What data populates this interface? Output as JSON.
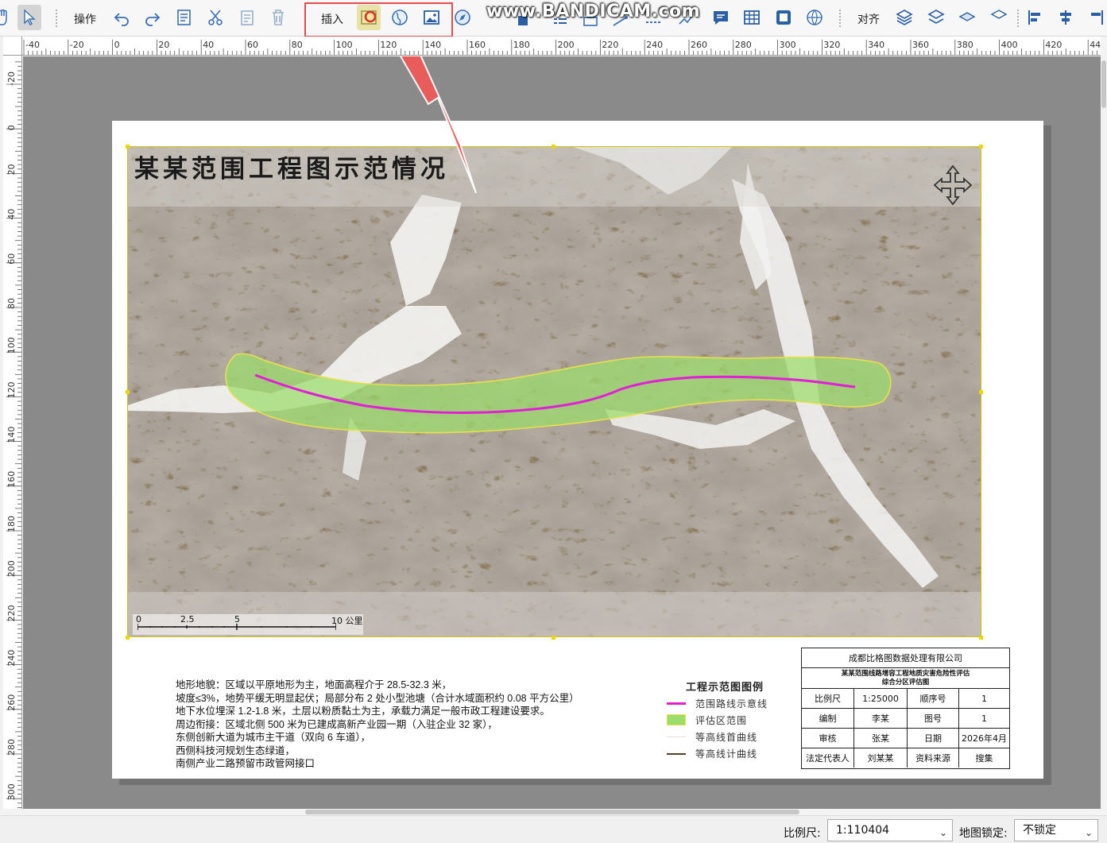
{
  "toolbar": {
    "operate_label": "操作",
    "insert_label": "插入",
    "align_label": "对齐"
  },
  "watermark": "www.BANDICAM.com",
  "ruler": {
    "h_ticks": [
      "-40",
      "-20",
      "0",
      "20",
      "40",
      "60",
      "80",
      "100",
      "120",
      "140",
      "160",
      "180",
      "200",
      "220",
      "240",
      "260",
      "280",
      "300",
      "320",
      "340",
      "360",
      "380",
      "400",
      "420",
      "440"
    ],
    "v_ticks": [
      "-20",
      "0",
      "20",
      "40",
      "60",
      "80",
      "100",
      "120",
      "140",
      "160",
      "180",
      "200",
      "220",
      "240",
      "260",
      "280",
      "300"
    ]
  },
  "map": {
    "title": "某某范围工程图示范情况",
    "scalebar": {
      "labels": [
        "0",
        "2.5",
        "5",
        "10 公里"
      ]
    }
  },
  "description": {
    "lines": [
      "地形地貌：区域以平原地形为主，地面高程介于 28.5-32.3 米，",
      "坡度≤3%，地势平缓无明显起伏；局部分布 2 处小型池塘（合计水域面积约 0.08 平方公里）",
      "地下水位埋深 1.2-1.8 米，土层以粉质黏土为主，承载力满足一般市政工程建设要求。",
      "周边衔接：区域北侧 500 米为已建成高新产业园一期（入驻企业 32 家），",
      "东侧创新大道为城市主干道（双向 6 车道），",
      "西侧科技河规划生态绿道，",
      "南侧产业二路预留市政管网接口"
    ]
  },
  "legend": {
    "title": "工程示范图图例",
    "items": [
      {
        "label": "范围路线示意线",
        "color": "#e21fd6"
      },
      {
        "label": "评估区范围",
        "color": "#9bdc6a"
      },
      {
        "label": "等高线首曲线",
        "color": "#e6ddd0"
      },
      {
        "label": "等高线计曲线",
        "color": "#5a3f1e"
      }
    ]
  },
  "titleblock": {
    "company": "成都比格图数据处理有限公司",
    "project_line1": "某某范围线路增容工程地质灾害危险性评估",
    "project_line2": "综合分区评估图",
    "rows": [
      [
        "比例尺",
        "1:25000",
        "顺序号",
        "1"
      ],
      [
        "编制",
        "李某",
        "图号",
        "1"
      ],
      [
        "审核",
        "张某",
        "日期",
        "2026年4月"
      ],
      [
        "法定代表人",
        "刘某某",
        "资料来源",
        "搜集"
      ]
    ]
  },
  "status": {
    "scale_label": "比例尺:",
    "scale_value": "1:110404",
    "lock_label": "地图锁定:",
    "lock_value": "不锁定"
  },
  "colors": {
    "highlight_box": "#e84a4a",
    "route_line": "#e21fd6",
    "assessment_area": "#9bdc6a",
    "contour_index": "#5a3f1e"
  }
}
